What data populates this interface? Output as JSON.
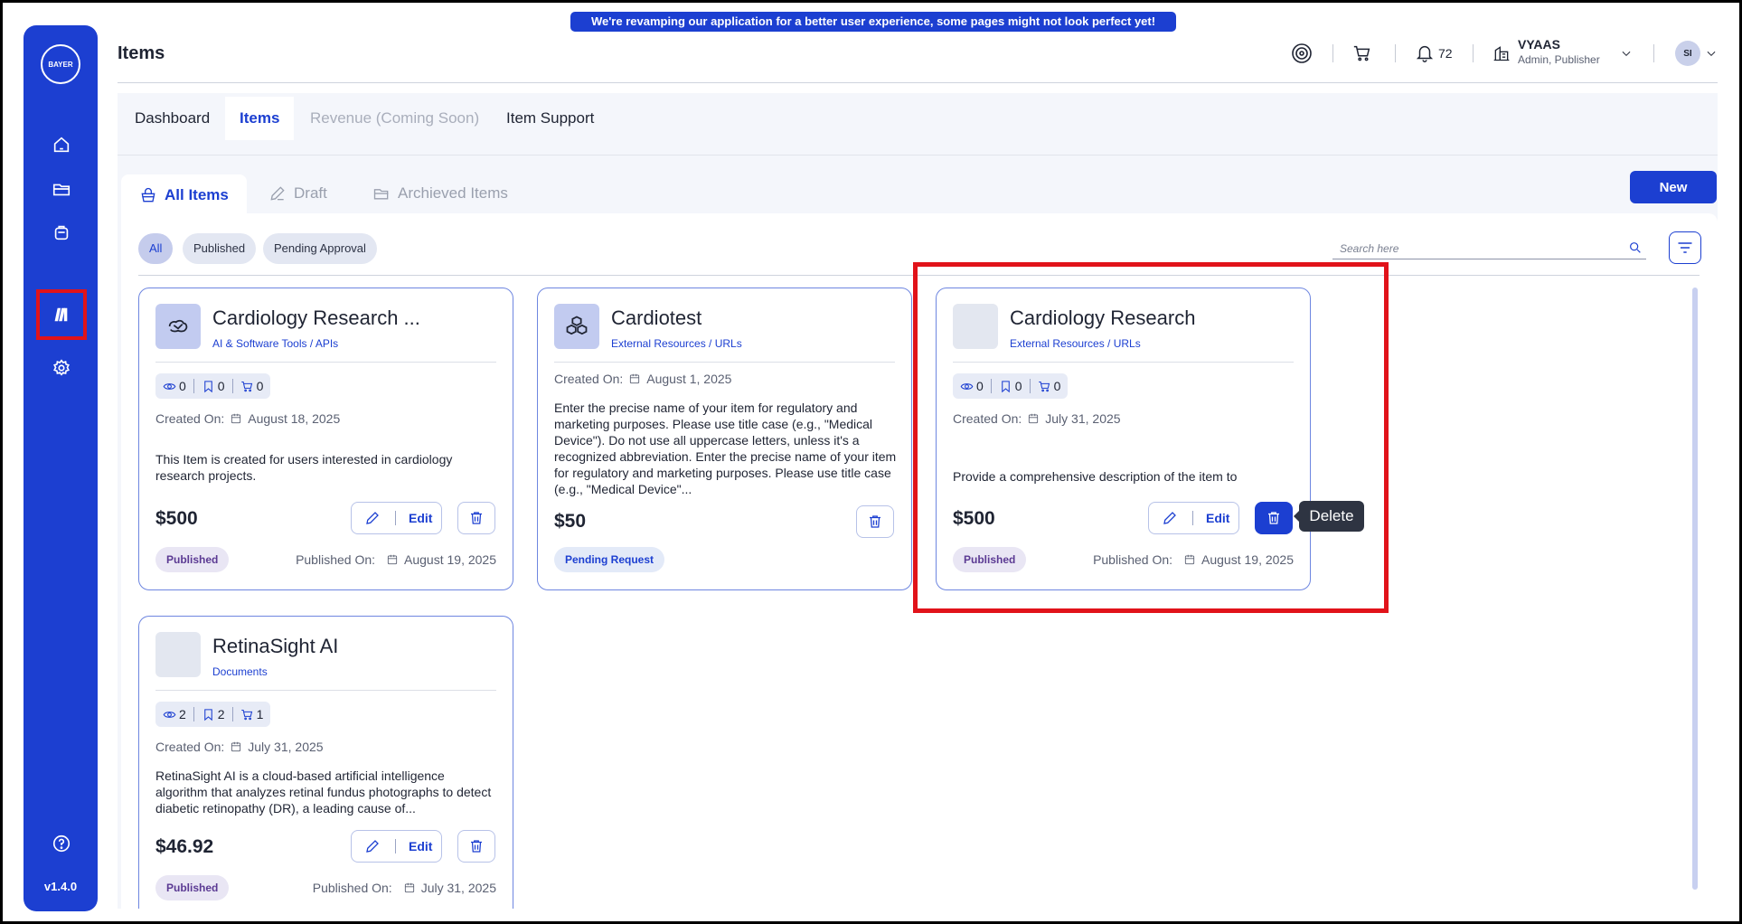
{
  "banner": "We're revamping our application for a better user experience, some pages might not look perfect yet!",
  "page_title": "Items",
  "header": {
    "notifications_count": "72",
    "user_name": "VYAAS",
    "user_role": "Admin, Publisher",
    "avatar_initials": "SI"
  },
  "sidebar": {
    "logo_text": "BAYER",
    "version": "v1.4.0",
    "items": [
      "home-icon",
      "folder-icon",
      "bag-icon",
      "catalog-icon",
      "gear-icon",
      "help-icon"
    ]
  },
  "tabs": [
    "Dashboard",
    "Items",
    "Revenue (Coming Soon)",
    "Item Support"
  ],
  "subtabs": [
    "All Items",
    "Draft",
    "Archieved Items"
  ],
  "new_button": "New",
  "filters": [
    "All",
    "Published",
    "Pending Approval"
  ],
  "search_placeholder": "Search here",
  "labels": {
    "created_on": "Created On:",
    "published_on": "Published On:",
    "edit": "Edit",
    "tooltip_delete": "Delete"
  },
  "cards": [
    {
      "title": "Cardiology Research ...",
      "category": "AI & Software Tools / APIs",
      "views": "0",
      "bookmarks": "0",
      "carts": "0",
      "created": "August 18, 2025",
      "description": "This Item is created for users interested in cardiology research projects.",
      "price": "$500",
      "status": "Published",
      "published": "August 19, 2025"
    },
    {
      "title": "Cardiotest",
      "category": "External Resources / URLs",
      "created": "August 1, 2025",
      "description": "Enter the precise name of your item for regulatory and marketing purposes. Please use title case (e.g., \"Medical Device\"). Do not use all uppercase letters, unless it's a recognized abbreviation. Enter the precise name of your item for regulatory and marketing purposes. Please use title case (e.g., \"Medical Device\"...",
      "price": "$50",
      "status": "Pending Request"
    },
    {
      "title": "Cardiology Research",
      "category": "External Resources / URLs",
      "views": "0",
      "bookmarks": "0",
      "carts": "0",
      "created": "July 31, 2025",
      "description": "Provide a comprehensive description of the item to",
      "price": "$500",
      "status": "Published",
      "published": "August 19, 2025"
    },
    {
      "title": "RetinaSight AI",
      "category": "Documents",
      "views": "2",
      "bookmarks": "2",
      "carts": "1",
      "created": "July 31, 2025",
      "description": "RetinaSight AI is a cloud-based artificial intelligence algorithm that analyzes retinal fundus photographs to detect diabetic retinopathy (DR), a leading cause of...",
      "price": "$46.92",
      "status": "Published",
      "published": "July 31, 2025"
    }
  ],
  "colors": {
    "brand": "#1c3fd1",
    "highlight": "#e1131a",
    "published_badge": "#5b3a93"
  }
}
